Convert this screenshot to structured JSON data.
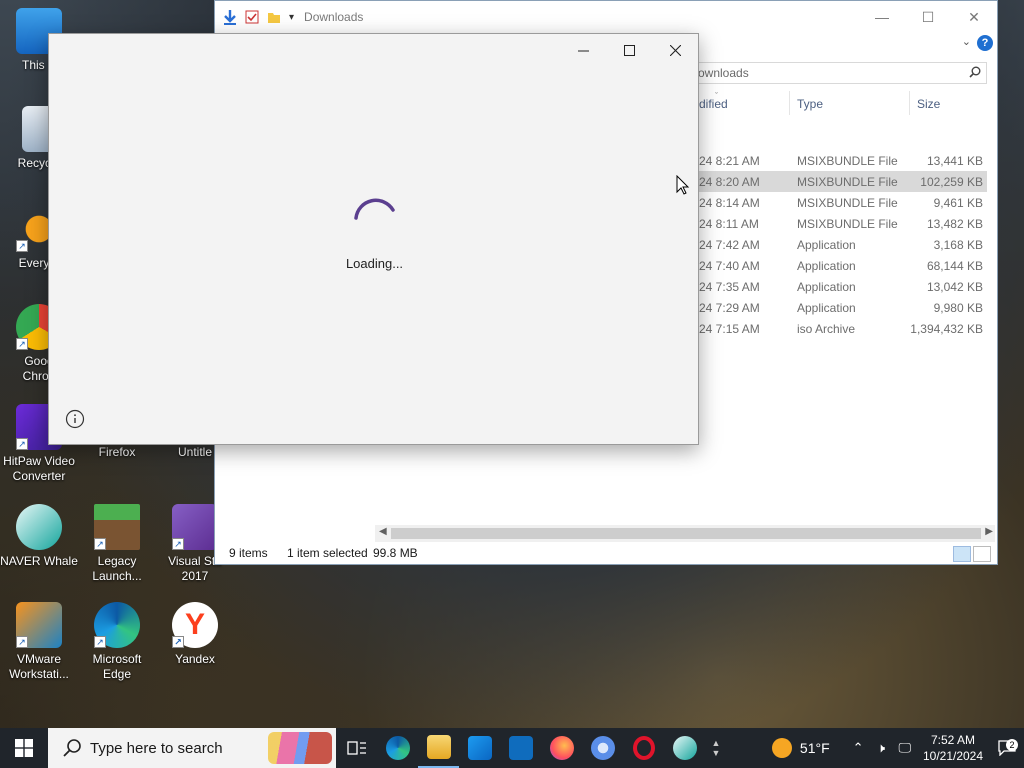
{
  "desktop": {
    "icons": [
      {
        "label": "This P",
        "shortcut": false
      },
      {
        "label": "Recycle",
        "shortcut": false
      },
      {
        "label": "Everyth",
        "shortcut": true
      },
      {
        "label": "Goog\nChron",
        "shortcut": true
      },
      {
        "label": "HitPaw Video Converter",
        "shortcut": true
      },
      {
        "label": "Firefox",
        "shortcut": false
      },
      {
        "label": "Untitle",
        "shortcut": false
      },
      {
        "label": "NAVER Whale",
        "shortcut": false
      },
      {
        "label": "Legacy Launch...",
        "shortcut": true
      },
      {
        "label": "Visual Stu 2017",
        "shortcut": true
      },
      {
        "label": "VMware Workstati...",
        "shortcut": true
      },
      {
        "label": "Microsoft Edge",
        "shortcut": true
      },
      {
        "label": "Yandex",
        "shortcut": true
      }
    ]
  },
  "explorer": {
    "title": "Downloads",
    "search_text": "ownloads",
    "columns": {
      "modified": "dified",
      "type": "Type",
      "size": "Size"
    },
    "files": [
      {
        "date": "24 8:21 AM",
        "type": "MSIXBUNDLE File",
        "size": "13,441 KB",
        "selected": false
      },
      {
        "date": "24 8:20 AM",
        "type": "MSIXBUNDLE File",
        "size": "102,259 KB",
        "selected": true
      },
      {
        "date": "24 8:14 AM",
        "type": "MSIXBUNDLE File",
        "size": "9,461 KB",
        "selected": false
      },
      {
        "date": "24 8:11 AM",
        "type": "MSIXBUNDLE File",
        "size": "13,482 KB",
        "selected": false
      },
      {
        "date": "24 7:42 AM",
        "type": "Application",
        "size": "3,168 KB",
        "selected": false
      },
      {
        "date": "24 7:40 AM",
        "type": "Application",
        "size": "68,144 KB",
        "selected": false
      },
      {
        "date": "24 7:35 AM",
        "type": "Application",
        "size": "13,042 KB",
        "selected": false
      },
      {
        "date": "24 7:29 AM",
        "type": "Application",
        "size": "9,980 KB",
        "selected": false
      },
      {
        "date": "24 7:15 AM",
        "type": "iso Archive",
        "size": "1,394,432 KB",
        "selected": false
      }
    ],
    "status": {
      "items": "9 items",
      "selected": "1 item selected",
      "size": "99.8 MB"
    },
    "help_glyph": "?"
  },
  "dialog": {
    "loading_text": "Loading..."
  },
  "taskbar": {
    "search_placeholder": "Type here to search",
    "apps": [
      "task-view",
      "edge",
      "file-explorer",
      "store",
      "outlook",
      "firefox",
      "chromium",
      "opera",
      "whale"
    ],
    "weather": "51°F",
    "time": "7:52 AM",
    "date": "10/21/2024",
    "notification_count": "2"
  },
  "colors": {
    "accent": "#1f6fd1",
    "spinner": "#5b3f8f",
    "selected_row": "#d9d9d9",
    "taskbar": "#20252b"
  }
}
